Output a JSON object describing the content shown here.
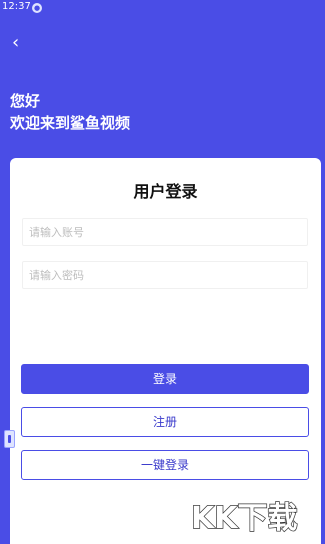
{
  "status_bar": {
    "time": "12:37"
  },
  "header": {
    "back_icon": "chevron-left-icon",
    "greeting_line1": "您好",
    "greeting_line2": "欢迎来到鲨鱼视频"
  },
  "login_card": {
    "title": "用户登录",
    "account_placeholder": "请输入账号",
    "password_placeholder": "请输入密码",
    "login_label": "登录",
    "register_label": "注册",
    "one_key_login_label": "一键登录"
  },
  "watermark": {
    "text": "KK下载"
  },
  "colors": {
    "primary": "#4a4de6",
    "card_bg": "#ffffff",
    "text_dark": "#111111"
  }
}
